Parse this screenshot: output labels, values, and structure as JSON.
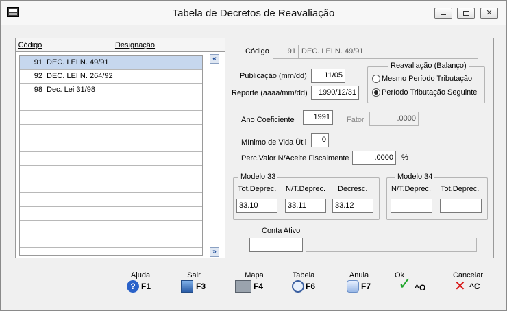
{
  "window": {
    "title": "Tabela de Decretos de Reavaliação"
  },
  "list": {
    "headers": {
      "codigo": "Código",
      "designacao": "Designação"
    },
    "rows": [
      {
        "codigo": "91",
        "designacao": "DEC. LEI N. 49/91",
        "selected": true
      },
      {
        "codigo": "92",
        "designacao": "DEC. LEI N. 264/92",
        "selected": false
      },
      {
        "codigo": "98",
        "designacao": "Dec. Lei 31/98",
        "selected": false
      }
    ],
    "empty_rows": 11
  },
  "form": {
    "codigo": {
      "label": "Código",
      "value": "91",
      "description": "DEC. LEI N. 49/91"
    },
    "publicacao": {
      "label": "Publicação (mm/dd)",
      "value": "11/05"
    },
    "reporte": {
      "label": "Reporte (aaaa/mm/dd)",
      "value": "1990/12/31"
    },
    "reavaliacao": {
      "title": "Reavaliação (Balanço)",
      "options": [
        {
          "label": "Mesmo Período Tributação",
          "selected": false
        },
        {
          "label": "Período Tributação Seguinte",
          "selected": true
        }
      ]
    },
    "ano_coeficiente": {
      "label": "Ano Coeficiente",
      "value": "1991"
    },
    "fator": {
      "label": "Fator",
      "value": ".0000"
    },
    "minimo_vida_util": {
      "label": "Mínimo de Vida Útil",
      "value": "0"
    },
    "perc_valor": {
      "label": "Perc.Valor N/Aceite Fiscalmente",
      "value": ".0000",
      "unit": "%"
    },
    "modelo33": {
      "title": "Modelo 33",
      "tot_deprec": {
        "label": "Tot.Deprec.",
        "value": "33.10"
      },
      "nt_deprec": {
        "label": "N/T.Deprec.",
        "value": "33.11"
      },
      "decresc": {
        "label": "Decresc.",
        "value": "33.12"
      }
    },
    "modelo34": {
      "title": "Modelo 34",
      "nt_deprec": {
        "label": "N/T.Deprec.",
        "value": ""
      },
      "tot_deprec": {
        "label": "Tot.Deprec.",
        "value": ""
      }
    },
    "conta_ativo": {
      "label": "Conta Ativo",
      "value": "",
      "description": ""
    }
  },
  "toolbar": [
    {
      "label": "Ajuda",
      "key": "F1",
      "icon": "help-icon"
    },
    {
      "label": "Sair",
      "key": "F3",
      "icon": "exit-icon"
    },
    {
      "label": "Mapa",
      "key": "F4",
      "icon": "printer-icon"
    },
    {
      "label": "Tabela",
      "key": "F6",
      "icon": "table-search-icon"
    },
    {
      "label": "Anula",
      "key": "F7",
      "icon": "anula-icon"
    },
    {
      "label": "Ok",
      "key": "^O",
      "icon": "check-icon"
    },
    {
      "label": "Cancelar",
      "key": "^C",
      "icon": "cancel-x-icon"
    }
  ]
}
